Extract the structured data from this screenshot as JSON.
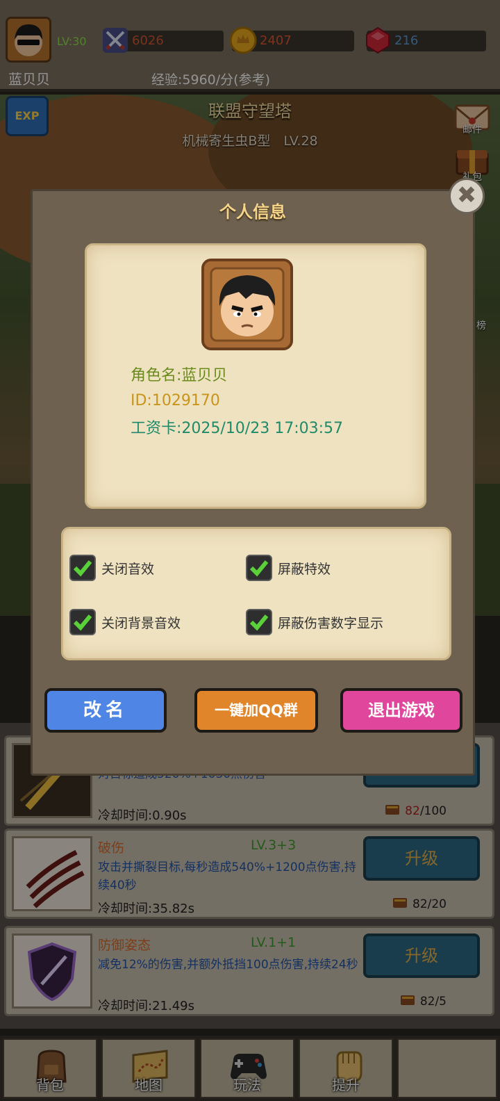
{
  "player": {
    "level": "LV:30",
    "name": "蓝贝贝",
    "exp": "经验:5960/分(参考)",
    "power": "6026",
    "gold": "2407",
    "gems": "216"
  },
  "scene": {
    "title": "联盟守望塔",
    "enemy": "机械寄生虫B型　LV.28",
    "exp_badge": "EXP",
    "side": {
      "mail_label": "邮件",
      "gift_label": "礼包",
      "rank_label": "榜"
    }
  },
  "modal": {
    "title": "个人信息",
    "close": "✖",
    "role_name": "角色名:蓝贝贝",
    "id": "ID:1029170",
    "salary_card": "工资卡:2025/10/23 17:03:57",
    "options": {
      "mute_sfx": "关闭音效",
      "hide_effects": "屏蔽特效",
      "mute_bgm": "关闭背景音效",
      "hide_damage": "屏蔽伤害数字显示"
    },
    "buttons": {
      "rename": "改名",
      "join_qq": "一键加QQ群",
      "quit": "退出游戏"
    }
  },
  "skills": [
    {
      "desc": "对目标造成520%+1030点伤害",
      "cooldown": "冷却时间:0.90s",
      "button": "升级",
      "cost_have": "82",
      "cost_need": "/100"
    },
    {
      "name": "破伤",
      "level": "LV.3+3",
      "desc": "攻击并撕裂目标,每秒造成540%+1200点伤害,持续40秒",
      "cooldown": "冷却时间:35.82s",
      "button": "升级",
      "cost_have": "82",
      "cost_need": "/20"
    },
    {
      "name": "防御姿态",
      "level": "LV.1+1",
      "desc": "减免12%的伤害,并额外抵挡100点伤害,持续24秒",
      "cooldown": "冷却时间:21.49s",
      "button": "升级",
      "cost_have": "82",
      "cost_need": "/5"
    }
  ],
  "nav": {
    "bag": "背包",
    "map": "地图",
    "play": "玩法",
    "upgrade": "提升"
  },
  "colors": {
    "modal_bg": "#6e6150",
    "parchment": "#efe2c0",
    "rename_btn": "#4f86e6",
    "qq_btn": "#e1852a",
    "quit_btn": "#e0479c"
  }
}
